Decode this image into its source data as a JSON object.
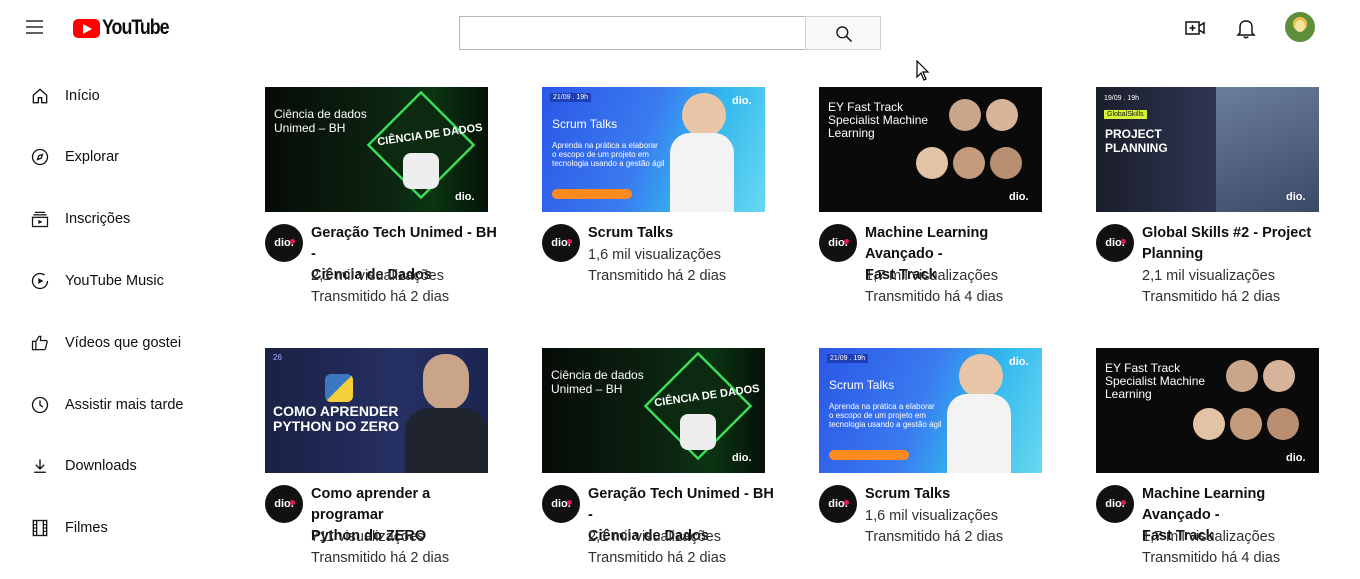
{
  "header": {
    "logo_text": "YouTube",
    "search_placeholder": "",
    "icons": [
      "menu-icon",
      "search-icon",
      "create-video-icon",
      "notifications-bell-icon",
      "user-avatar"
    ]
  },
  "sidebar": {
    "items": [
      {
        "label": "Início",
        "icon": "home-icon"
      },
      {
        "label": "Explorar",
        "icon": "compass-icon"
      },
      {
        "label": "Inscrições",
        "icon": "subscriptions-icon"
      },
      {
        "label": "YouTube Music",
        "icon": "youtube-music-icon"
      },
      {
        "label": "Vídeos que gostei",
        "icon": "thumbs-up-icon"
      },
      {
        "label": "Assistir mais tarde",
        "icon": "clock-icon"
      },
      {
        "label": "Downloads",
        "icon": "download-icon"
      },
      {
        "label": "Filmes",
        "icon": "film-icon"
      }
    ]
  },
  "videos": [
    {
      "title_line1": "Geração Tech Unimed - BH -",
      "title_line2": "Ciência de Dados",
      "views": "2,1 mil visualizações",
      "time": "Transmitido há 2 dias",
      "thumb": {
        "line1": "Ciência de dados",
        "line2": "Unimed – BH",
        "badge": "CIÊNCIA DE DADOS",
        "brand": "dio."
      }
    },
    {
      "title_line1": "Scrum Talks",
      "title_line2": "",
      "views": "1,6 mil visualizações",
      "time": "Transmitido há 2 dias",
      "thumb": {
        "date": "21/09 . 19h",
        "line1": "Scrum Talks",
        "sub1": "Aprenda na prática a elaborar",
        "sub2": "o escopo de um projeto em",
        "sub3": "tecnologia usando a gestão ágil",
        "brand": "dio."
      }
    },
    {
      "title_line1": "Machine Learning Avançado -",
      "title_line2": "Fast Track",
      "views": "1,7 mil visualizações",
      "time": "Transmitido há 4 dias",
      "thumb": {
        "line1": "EY Fast Track",
        "line2": "Specialist Machine",
        "line3": "Learning",
        "brand": "dio."
      }
    },
    {
      "title_line1": "Global Skills #2 - Project",
      "title_line2": "Planning",
      "views": "2,1 mil visualizações",
      "time": "Transmitido há 2 dias",
      "thumb": {
        "date": "19/09 . 19h",
        "tag": "GlobalSkills",
        "line1": "PROJECT",
        "line2": "PLANNING",
        "brand": "dio."
      }
    },
    {
      "title_line1": "Como aprender a programar",
      "title_line2": "Python do ZERO",
      "views": "711 visualizações",
      "time": "Transmitido há 2 dias",
      "thumb": {
        "num": "26",
        "line1": "COMO APRENDER",
        "line2": "PYTHON DO ZERO"
      }
    },
    {
      "title_line1": "Geração Tech Unimed - BH -",
      "title_line2": "Ciência de Dados",
      "views": "2,1 mil visualizações",
      "time": "Transmitido há 2 dias",
      "thumb": {
        "line1": "Ciência de dados",
        "line2": "Unimed – BH",
        "badge": "CIÊNCIA DE DADOS",
        "brand": "dio."
      }
    },
    {
      "title_line1": "Scrum Talks",
      "title_line2": "",
      "views": "1,6 mil visualizações",
      "time": "Transmitido há 2 dias",
      "thumb": {
        "date": "21/09 . 19h",
        "line1": "Scrum Talks",
        "sub1": "Aprenda na prática a elaborar",
        "sub2": "o escopo de um projeto em",
        "sub3": "tecnologia usando a gestão ágil",
        "brand": "dio."
      }
    },
    {
      "title_line1": "Machine Learning Avançado -",
      "title_line2": "Fast Track",
      "views": "1,7 mil visualizações",
      "time": "Transmitido há 4 dias",
      "thumb": {
        "line1": "EY Fast Track",
        "line2": "Specialist Machine",
        "line3": "Learning",
        "brand": "dio."
      }
    }
  ],
  "channel_avatar_text": "dio.",
  "colors": {
    "brand_red": "#ff0000",
    "dio_pink": "#e01b4c",
    "text": "#0f0f0f",
    "meta": "#303030"
  }
}
